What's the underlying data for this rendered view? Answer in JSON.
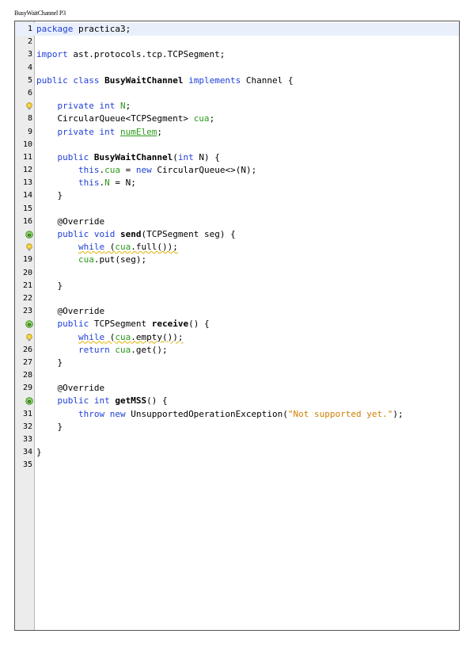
{
  "page_title": "BusyWaitChannel P3",
  "editor": {
    "lines": [
      {
        "n": "1",
        "highlight": true,
        "mark": "",
        "tokens": [
          {
            "t": "package",
            "c": "kw"
          },
          {
            "t": " practica3;",
            "c": ""
          }
        ]
      },
      {
        "n": "2",
        "mark": "",
        "tokens": []
      },
      {
        "n": "3",
        "mark": "",
        "tokens": [
          {
            "t": "import",
            "c": "kw"
          },
          {
            "t": " ast.protocols.tcp.TCPSegment;",
            "c": ""
          }
        ]
      },
      {
        "n": "4",
        "mark": "",
        "tokens": []
      },
      {
        "n": "5",
        "mark": "",
        "tokens": [
          {
            "t": "public class",
            "c": "kw"
          },
          {
            "t": " ",
            "c": ""
          },
          {
            "t": "BusyWaitChannel",
            "c": "b"
          },
          {
            "t": " ",
            "c": ""
          },
          {
            "t": "implements",
            "c": "kw"
          },
          {
            "t": " Channel {",
            "c": ""
          }
        ]
      },
      {
        "n": "6",
        "mark": "",
        "tokens": []
      },
      {
        "n": "",
        "mark": "hint",
        "tokens": [
          {
            "t": "    ",
            "c": ""
          },
          {
            "t": "private int",
            "c": "kw"
          },
          {
            "t": " ",
            "c": ""
          },
          {
            "t": "N",
            "c": "fld"
          },
          {
            "t": ";",
            "c": ""
          }
        ]
      },
      {
        "n": "8",
        "mark": "",
        "tokens": [
          {
            "t": "    CircularQueue<TCPSegment> ",
            "c": ""
          },
          {
            "t": "cua",
            "c": "fld"
          },
          {
            "t": ";",
            "c": ""
          }
        ]
      },
      {
        "n": "9",
        "mark": "",
        "tokens": [
          {
            "t": "    ",
            "c": ""
          },
          {
            "t": "private int",
            "c": "kw"
          },
          {
            "t": " ",
            "c": ""
          },
          {
            "t": "numElem",
            "c": "fld u"
          },
          {
            "t": ";",
            "c": ""
          }
        ]
      },
      {
        "n": "10",
        "mark": "",
        "tokens": []
      },
      {
        "n": "11",
        "mark": "",
        "tokens": [
          {
            "t": "    ",
            "c": ""
          },
          {
            "t": "public",
            "c": "kw"
          },
          {
            "t": " ",
            "c": ""
          },
          {
            "t": "BusyWaitChannel",
            "c": "b"
          },
          {
            "t": "(",
            "c": ""
          },
          {
            "t": "int",
            "c": "kw"
          },
          {
            "t": " N) {",
            "c": ""
          }
        ]
      },
      {
        "n": "12",
        "mark": "",
        "tokens": [
          {
            "t": "        ",
            "c": ""
          },
          {
            "t": "this",
            "c": "kw"
          },
          {
            "t": ".",
            "c": ""
          },
          {
            "t": "cua",
            "c": "fld"
          },
          {
            "t": " = ",
            "c": ""
          },
          {
            "t": "new",
            "c": "kw"
          },
          {
            "t": " CircularQueue<>(N);",
            "c": ""
          }
        ]
      },
      {
        "n": "13",
        "mark": "",
        "tokens": [
          {
            "t": "        ",
            "c": ""
          },
          {
            "t": "this",
            "c": "kw"
          },
          {
            "t": ".",
            "c": ""
          },
          {
            "t": "N",
            "c": "fld"
          },
          {
            "t": " = N;",
            "c": ""
          }
        ]
      },
      {
        "n": "14",
        "mark": "",
        "tokens": [
          {
            "t": "    }",
            "c": ""
          }
        ]
      },
      {
        "n": "15",
        "mark": "",
        "tokens": []
      },
      {
        "n": "16",
        "mark": "",
        "tokens": [
          {
            "t": "    @Override",
            "c": ""
          }
        ]
      },
      {
        "n": "",
        "mark": "override",
        "tokens": [
          {
            "t": "    ",
            "c": ""
          },
          {
            "t": "public void",
            "c": "kw"
          },
          {
            "t": " ",
            "c": ""
          },
          {
            "t": "send",
            "c": "b"
          },
          {
            "t": "(TCPSegment seg) {",
            "c": ""
          }
        ]
      },
      {
        "n": "",
        "mark": "hint",
        "tokens": [
          {
            "t": "        ",
            "c": ""
          },
          {
            "t": "while",
            "c": "kw warn-ul"
          },
          {
            "t": " (",
            "c": "warn-ul"
          },
          {
            "t": "cua",
            "c": "fld warn-ul"
          },
          {
            "t": ".full());",
            "c": "warn-ul"
          }
        ]
      },
      {
        "n": "19",
        "mark": "",
        "tokens": [
          {
            "t": "        ",
            "c": ""
          },
          {
            "t": "cua",
            "c": "fld"
          },
          {
            "t": ".put(seg);",
            "c": ""
          }
        ]
      },
      {
        "n": "20",
        "mark": "",
        "tokens": []
      },
      {
        "n": "21",
        "mark": "",
        "tokens": [
          {
            "t": "    }",
            "c": ""
          }
        ]
      },
      {
        "n": "22",
        "mark": "",
        "tokens": []
      },
      {
        "n": "23",
        "mark": "",
        "tokens": [
          {
            "t": "    @Override",
            "c": ""
          }
        ]
      },
      {
        "n": "",
        "mark": "override",
        "tokens": [
          {
            "t": "    ",
            "c": ""
          },
          {
            "t": "public",
            "c": "kw"
          },
          {
            "t": " TCPSegment ",
            "c": ""
          },
          {
            "t": "receive",
            "c": "b"
          },
          {
            "t": "() {",
            "c": ""
          }
        ]
      },
      {
        "n": "",
        "mark": "hint",
        "tokens": [
          {
            "t": "        ",
            "c": ""
          },
          {
            "t": "while",
            "c": "kw warn-ul"
          },
          {
            "t": " (",
            "c": "warn-ul"
          },
          {
            "t": "cua",
            "c": "fld warn-ul"
          },
          {
            "t": ".empty());",
            "c": "warn-ul"
          }
        ]
      },
      {
        "n": "26",
        "mark": "",
        "tokens": [
          {
            "t": "        ",
            "c": ""
          },
          {
            "t": "return",
            "c": "kw"
          },
          {
            "t": " ",
            "c": ""
          },
          {
            "t": "cua",
            "c": "fld"
          },
          {
            "t": ".get();",
            "c": ""
          }
        ]
      },
      {
        "n": "27",
        "mark": "",
        "tokens": [
          {
            "t": "    }",
            "c": ""
          }
        ]
      },
      {
        "n": "28",
        "mark": "",
        "tokens": []
      },
      {
        "n": "29",
        "mark": "",
        "tokens": [
          {
            "t": "    @Override",
            "c": ""
          }
        ]
      },
      {
        "n": "",
        "mark": "override",
        "tokens": [
          {
            "t": "    ",
            "c": ""
          },
          {
            "t": "public int",
            "c": "kw"
          },
          {
            "t": " ",
            "c": ""
          },
          {
            "t": "getMSS",
            "c": "b"
          },
          {
            "t": "() {",
            "c": ""
          }
        ]
      },
      {
        "n": "31",
        "mark": "",
        "tokens": [
          {
            "t": "        ",
            "c": ""
          },
          {
            "t": "throw new",
            "c": "kw"
          },
          {
            "t": " UnsupportedOperationException(",
            "c": ""
          },
          {
            "t": "\"Not supported yet.\"",
            "c": "str"
          },
          {
            "t": ");",
            "c": ""
          }
        ]
      },
      {
        "n": "32",
        "mark": "",
        "tokens": [
          {
            "t": "    }",
            "c": ""
          }
        ]
      },
      {
        "n": "33",
        "mark": "",
        "tokens": []
      },
      {
        "n": "34",
        "mark": "",
        "tokens": [
          {
            "t": "}",
            "c": ""
          }
        ]
      },
      {
        "n": "35",
        "mark": "",
        "tokens": []
      }
    ],
    "icons": {
      "hint": "lightbulb-warning-icon",
      "override": "override-annotation-icon"
    }
  }
}
